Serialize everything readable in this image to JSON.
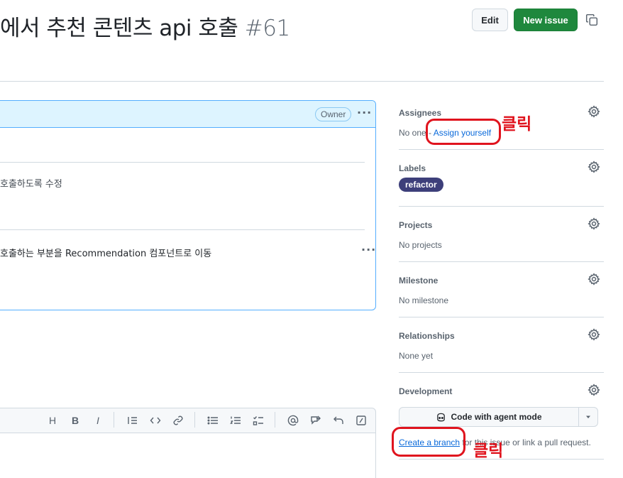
{
  "issue": {
    "title": "에서 추천 콘텐츠 api 호출",
    "number": "#61"
  },
  "header": {
    "edit_label": "Edit",
    "new_issue_label": "New issue"
  },
  "comment": {
    "owner_badge": "Owner",
    "line1": "호출하도록 수정",
    "line2": "호출하는 부분을 Recommendation 컴포넌트로 이동"
  },
  "editor": {
    "toolbar": [
      "heading",
      "bold",
      "italic",
      "quote",
      "code",
      "link",
      "unordered-list",
      "ordered-list",
      "task-list",
      "mention",
      "reference",
      "undo",
      "slash-command"
    ],
    "heading_label": "H",
    "bold_label": "B",
    "italic_label": "I"
  },
  "sidebar": {
    "assignees": {
      "heading": "Assignees",
      "none": "No one",
      "sep": "-",
      "assign_link": "Assign yourself"
    },
    "labels": {
      "heading": "Labels",
      "items": [
        "refactor"
      ],
      "label_color": "#3d3f7a"
    },
    "projects": {
      "heading": "Projects",
      "value": "No projects"
    },
    "milestone": {
      "heading": "Milestone",
      "value": "No milestone"
    },
    "relationships": {
      "heading": "Relationships",
      "value": "None yet"
    },
    "development": {
      "heading": "Development",
      "agent_button": "Code with agent mode",
      "create_branch": "Create a branch",
      "note_tail": " for this issue or link a pull request."
    }
  },
  "annotations": {
    "click1": "클릭",
    "click2": "클릭",
    "color": "#e0141e"
  },
  "colors": {
    "primary_green": "#1f883d",
    "link_blue": "#0969da",
    "comment_header_bg": "#ddf4ff"
  }
}
